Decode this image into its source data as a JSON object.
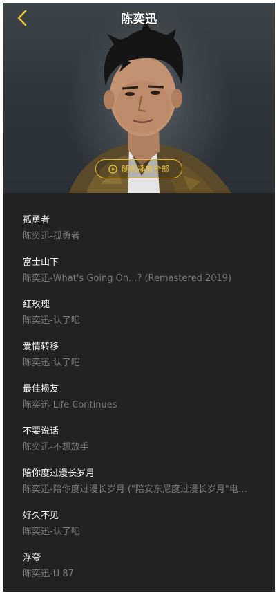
{
  "header": {
    "title": "陈奕迅",
    "back_icon": "chevron-left-icon",
    "accent_color": "#f2c230"
  },
  "hero": {
    "shuffle_label": "随机播放全部",
    "shuffle_icon": "play-circle-icon"
  },
  "songs": [
    {
      "title": "孤勇者",
      "subtitle": "陈奕迅-孤勇者"
    },
    {
      "title": "富士山下",
      "subtitle": "陈奕迅-What's Going On...? (Remastered 2019)"
    },
    {
      "title": "红玫瑰",
      "subtitle": "陈奕迅-认了吧"
    },
    {
      "title": "爱情转移",
      "subtitle": "陈奕迅-认了吧"
    },
    {
      "title": "最佳损友",
      "subtitle": "陈奕迅-Life Continues"
    },
    {
      "title": "不要说话",
      "subtitle": "陈奕迅-不想放手"
    },
    {
      "title": "陪你度过漫长岁月",
      "subtitle": "陈奕迅-陪你度过漫长岁月 (\"陪安东尼度过漫长岁月\"电影主题曲)"
    },
    {
      "title": "好久不见",
      "subtitle": "陈奕迅-认了吧"
    },
    {
      "title": "浮夸",
      "subtitle": "陈奕迅-U 87"
    }
  ]
}
